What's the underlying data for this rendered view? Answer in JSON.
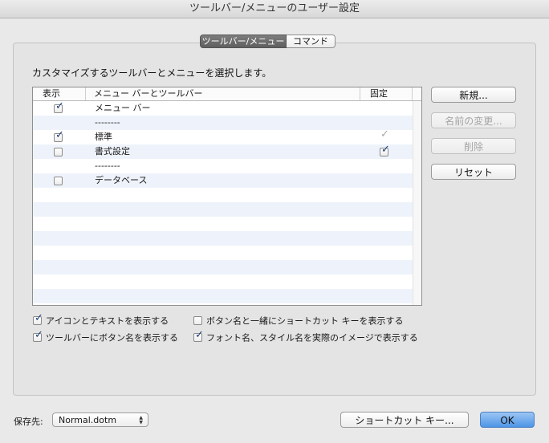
{
  "window": {
    "title": "ツールバー/メニューのユーザー設定"
  },
  "tabs": [
    {
      "label": "ツールバー/メニュー",
      "active": true
    },
    {
      "label": "コマンド",
      "active": false
    }
  ],
  "instruction": "カスタマイズするツールバーとメニューを選択します。",
  "table": {
    "headers": {
      "show": "表示",
      "name": "メニュー バーとツールバー",
      "fixed": "固定"
    },
    "rows": [
      {
        "name": "メニュー バー",
        "show": true
      },
      {
        "name": "--------"
      },
      {
        "name": "標準",
        "show": true,
        "fixed": "dim"
      },
      {
        "name": "書式設定",
        "show": false,
        "fixed": true
      },
      {
        "name": "--------"
      },
      {
        "name": "データベース",
        "show": false
      }
    ]
  },
  "buttons": {
    "new": "新規...",
    "rename": "名前の変更...",
    "delete": "削除",
    "reset": "リセット",
    "shortcut": "ショートカット キー...",
    "ok": "OK"
  },
  "options": {
    "icon_text": {
      "label": "アイコンとテキストを表示する",
      "checked": true
    },
    "button_names": {
      "label": "ツールバーにボタン名を表示する",
      "checked": true
    },
    "shortcut_keys": {
      "label": "ボタン名と一緒にショートカット キーを表示する",
      "checked": false
    },
    "font_preview": {
      "label": "フォント名、スタイル名を実際のイメージで表示する",
      "checked": true
    }
  },
  "save": {
    "label": "保存先:",
    "value": "Normal.dotm"
  }
}
